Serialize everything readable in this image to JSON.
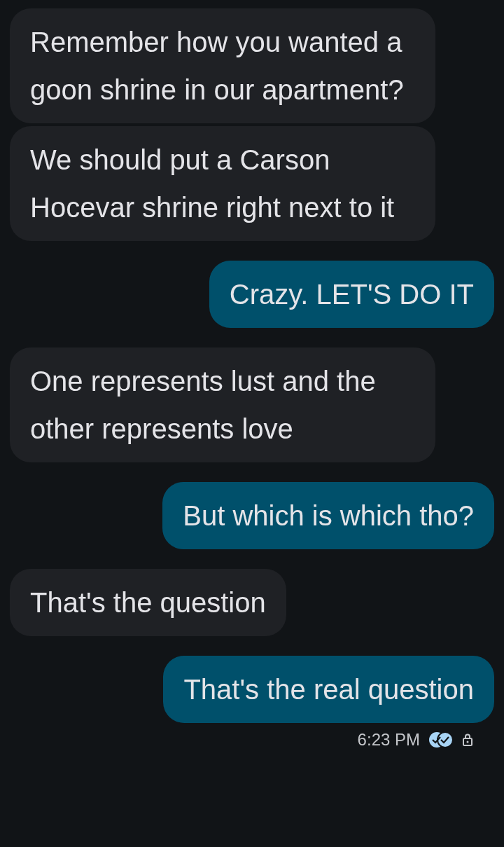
{
  "messages": [
    {
      "outgoing": false,
      "text": "Remember how you wanted a goon shrine in our apartment?"
    },
    {
      "outgoing": false,
      "text": "We should put a Carson Hocevar shrine right next to it"
    },
    {
      "outgoing": true,
      "text": "Crazy. LET'S DO IT"
    },
    {
      "outgoing": false,
      "text": "One represents lust and the other represents love"
    },
    {
      "outgoing": true,
      "text": "But which is which tho?"
    },
    {
      "outgoing": false,
      "text": "That's the question"
    },
    {
      "outgoing": true,
      "text": "That's the real question"
    }
  ],
  "status": {
    "time": "6:23 PM"
  }
}
